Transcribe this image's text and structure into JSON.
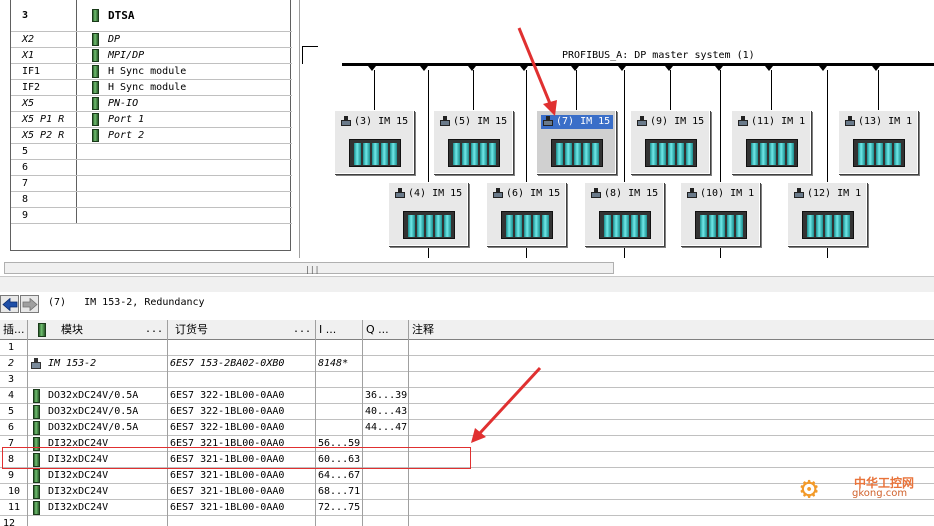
{
  "rack": {
    "rows": [
      {
        "slot": "3",
        "module": "DTSA",
        "slot_style": "bold",
        "module_style": "bold"
      },
      {
        "slot": "X2",
        "module": "DP",
        "slot_style": "italic",
        "module_style": "italic"
      },
      {
        "slot": "X1",
        "module": "MPI/DP",
        "slot_style": "italic",
        "module_style": "italic"
      },
      {
        "slot": "IF1",
        "module": "H Sync module",
        "slot_style": "",
        "module_style": ""
      },
      {
        "slot": "IF2",
        "module": "H Sync module",
        "slot_style": "",
        "module_style": ""
      },
      {
        "slot": "X5",
        "module": "PN-IO",
        "slot_style": "italic",
        "module_style": "italic"
      },
      {
        "slot": "X5 P1 R",
        "module": "Port 1",
        "slot_style": "italic",
        "module_style": "italic"
      },
      {
        "slot": "X5 P2 R",
        "module": "Port 2",
        "slot_style": "italic",
        "module_style": "italic"
      },
      {
        "slot": "5",
        "module": "",
        "slot_style": "",
        "module_style": ""
      },
      {
        "slot": "6",
        "module": "",
        "slot_style": "",
        "module_style": ""
      },
      {
        "slot": "7",
        "module": "",
        "slot_style": "",
        "module_style": ""
      },
      {
        "slot": "8",
        "module": "",
        "slot_style": "",
        "module_style": ""
      },
      {
        "slot": "9",
        "module": "",
        "slot_style": "",
        "module_style": ""
      }
    ]
  },
  "network": {
    "bus_label": "PROFIBUS_A: DP master system (1)",
    "stations_top": [
      {
        "label": "(3) IM 15",
        "selected": false
      },
      {
        "label": "(5) IM 15",
        "selected": false
      },
      {
        "label": "(7) IM 15",
        "selected": true
      },
      {
        "label": "(9) IM 15",
        "selected": false
      },
      {
        "label": "(11) IM 1",
        "selected": false
      },
      {
        "label": "(13) IM 1",
        "selected": false
      }
    ],
    "stations_bottom": [
      {
        "label": "(4) IM 15",
        "selected": false
      },
      {
        "label": "(6) IM 15",
        "selected": false
      },
      {
        "label": "(8) IM 15",
        "selected": false
      },
      {
        "label": "(10) IM 1",
        "selected": false
      },
      {
        "label": "(12) IM 1",
        "selected": false
      }
    ]
  },
  "detail": {
    "title": "(7)   IM 153-2, Redundancy",
    "headers": {
      "slot": "插...",
      "module": "模块",
      "module_dots": "...",
      "order": "订货号",
      "order_dots": "...",
      "i_addr": "I ...",
      "q_addr": "Q ...",
      "comment": "注释"
    },
    "rows": [
      {
        "slot": "1",
        "module": "",
        "order": "",
        "i": "",
        "q": "",
        "icon": "none",
        "italic": false
      },
      {
        "slot": "2",
        "module": "IM 153-2",
        "order": "6ES7 153-2BA02-0XB0",
        "i": "8148*",
        "q": "",
        "icon": "station",
        "italic": true
      },
      {
        "slot": "3",
        "module": "",
        "order": "",
        "i": "",
        "q": "",
        "icon": "none",
        "italic": false
      },
      {
        "slot": "4",
        "module": "DO32xDC24V/0.5A",
        "order": "6ES7 322-1BL00-0AA0",
        "i": "",
        "q": "36...39",
        "icon": "module",
        "italic": false
      },
      {
        "slot": "5",
        "module": "DO32xDC24V/0.5A",
        "order": "6ES7 322-1BL00-0AA0",
        "i": "",
        "q": "40...43",
        "icon": "module",
        "italic": false
      },
      {
        "slot": "6",
        "module": "DO32xDC24V/0.5A",
        "order": "6ES7 322-1BL00-0AA0",
        "i": "",
        "q": "44...47",
        "icon": "module",
        "italic": false
      },
      {
        "slot": "7",
        "module": "DI32xDC24V",
        "order": "6ES7 321-1BL00-0AA0",
        "i": "56...59",
        "q": "",
        "icon": "module",
        "italic": false
      },
      {
        "slot": "8",
        "module": "DI32xDC24V",
        "order": "6ES7 321-1BL00-0AA0",
        "i": "60...63",
        "q": "",
        "icon": "module",
        "italic": false
      },
      {
        "slot": "9",
        "module": "DI32xDC24V",
        "order": "6ES7 321-1BL00-0AA0",
        "i": "64...67",
        "q": "",
        "icon": "module",
        "italic": false
      },
      {
        "slot": "10",
        "module": "DI32xDC24V",
        "order": "6ES7 321-1BL00-0AA0",
        "i": "68...71",
        "q": "",
        "icon": "module",
        "italic": false
      },
      {
        "slot": "11",
        "module": "DI32xDC24V",
        "order": "6ES7 321-1BL00-0AA0",
        "i": "72...75",
        "q": "",
        "icon": "module",
        "italic": false
      },
      {
        "slot": "12",
        "module": "",
        "order": "",
        "i": "",
        "q": "",
        "icon": "none",
        "italic": false
      }
    ]
  },
  "watermark": {
    "line1": "中华工控网",
    "line2": "gkong.com"
  },
  "colors": {
    "selection": "#3a6ec8",
    "annotation": "#e03030",
    "watermark": "#f29a2a"
  }
}
